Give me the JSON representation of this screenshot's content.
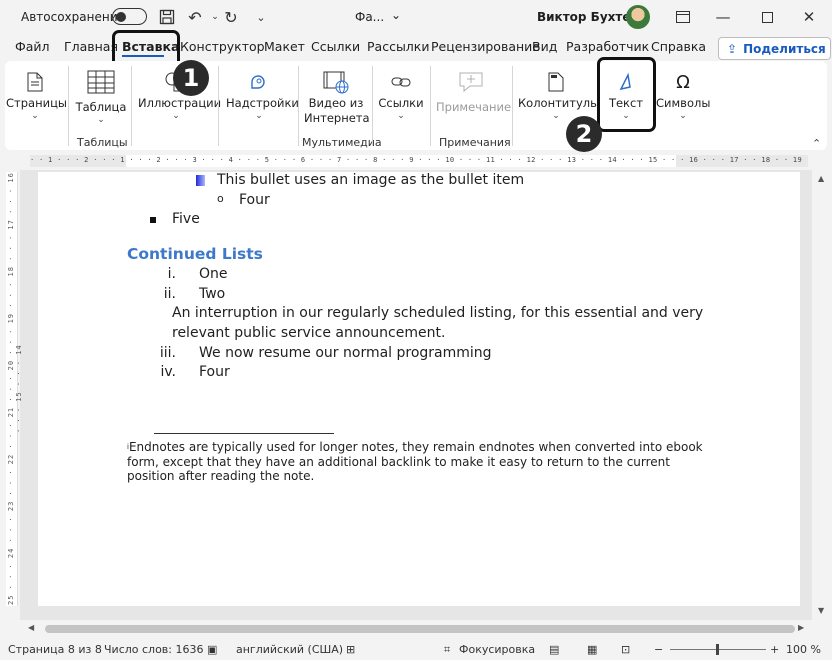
{
  "titlebar": {
    "autosave_label": "Автосохранение",
    "doc_title": "Фа...",
    "user_name": "Виктор Бухтеев"
  },
  "tabs": [
    {
      "label": "Файл"
    },
    {
      "label": "Главная"
    },
    {
      "label": "Вставка",
      "active": true
    },
    {
      "label": "Конструктор"
    },
    {
      "label": "Макет"
    },
    {
      "label": "Ссылки"
    },
    {
      "label": "Рассылки"
    },
    {
      "label": "Рецензирование"
    },
    {
      "label": "Вид"
    },
    {
      "label": "Разработчик"
    },
    {
      "label": "Справка"
    }
  ],
  "share_label": "Поделиться",
  "ribbon": {
    "pages": "Страницы",
    "table": "Таблица",
    "illustrations": "Иллюстрации",
    "addins": "Надстройки",
    "video_line1": "Видео из",
    "video_line2": "Интернета",
    "links": "Ссылки",
    "comment": "Примечание",
    "headers": "Колонтитулы",
    "text": "Текст",
    "symbols": "Символы",
    "groups": {
      "tables": "Таблицы",
      "media": "Мультимедиа",
      "comments": "Примечания"
    }
  },
  "badges": {
    "one": "1",
    "two": "2"
  },
  "document": {
    "bullet_image_item": "This bullet uses an image as the bullet item",
    "four_sub": "Four",
    "five": "Five",
    "heading": "Continued Lists",
    "items": [
      {
        "num": "i.",
        "text": "One"
      },
      {
        "num": "ii.",
        "text": "Two"
      }
    ],
    "interruption_line1": "An interruption in our regularly scheduled listing, for this essential and very",
    "interruption_line2": "relevant public service announcement.",
    "items_cont": [
      {
        "num": "iii.",
        "text": "We now resume our normal programming"
      },
      {
        "num": "iv.",
        "text": "Four"
      }
    ],
    "footnote_mark": "i",
    "footnote": "Endnotes are typically used for longer notes, they remain endnotes when converted into ebook form, except that they have an additional backlink to make it easy to return to the current position after reading the note."
  },
  "ruler": {
    "horizontal": "· · 1 · · · 2 · · · 1 · · · 2 · · · 3 · · · 4 · · · 5 · · · 6 · · · 7 · · · 8 · · · 9 · · · 10 · · · 11 · · · 12 · · · 13 · · · 14 · · · 15 · · · 16 · · · 17 · · 18 · · 19",
    "vertical": "25 · · · 24 · · · 23 · · · 22 · · · 21 · · · 20 · · · 19 · · · 18 · · · 17 · · · 16 · · · 15 · · · 14"
  },
  "status": {
    "page": "Страница 8 из 8",
    "words": "Число слов: 1636",
    "language": "английский (США)",
    "focus": "Фокусировка",
    "zoom": "100 %"
  }
}
